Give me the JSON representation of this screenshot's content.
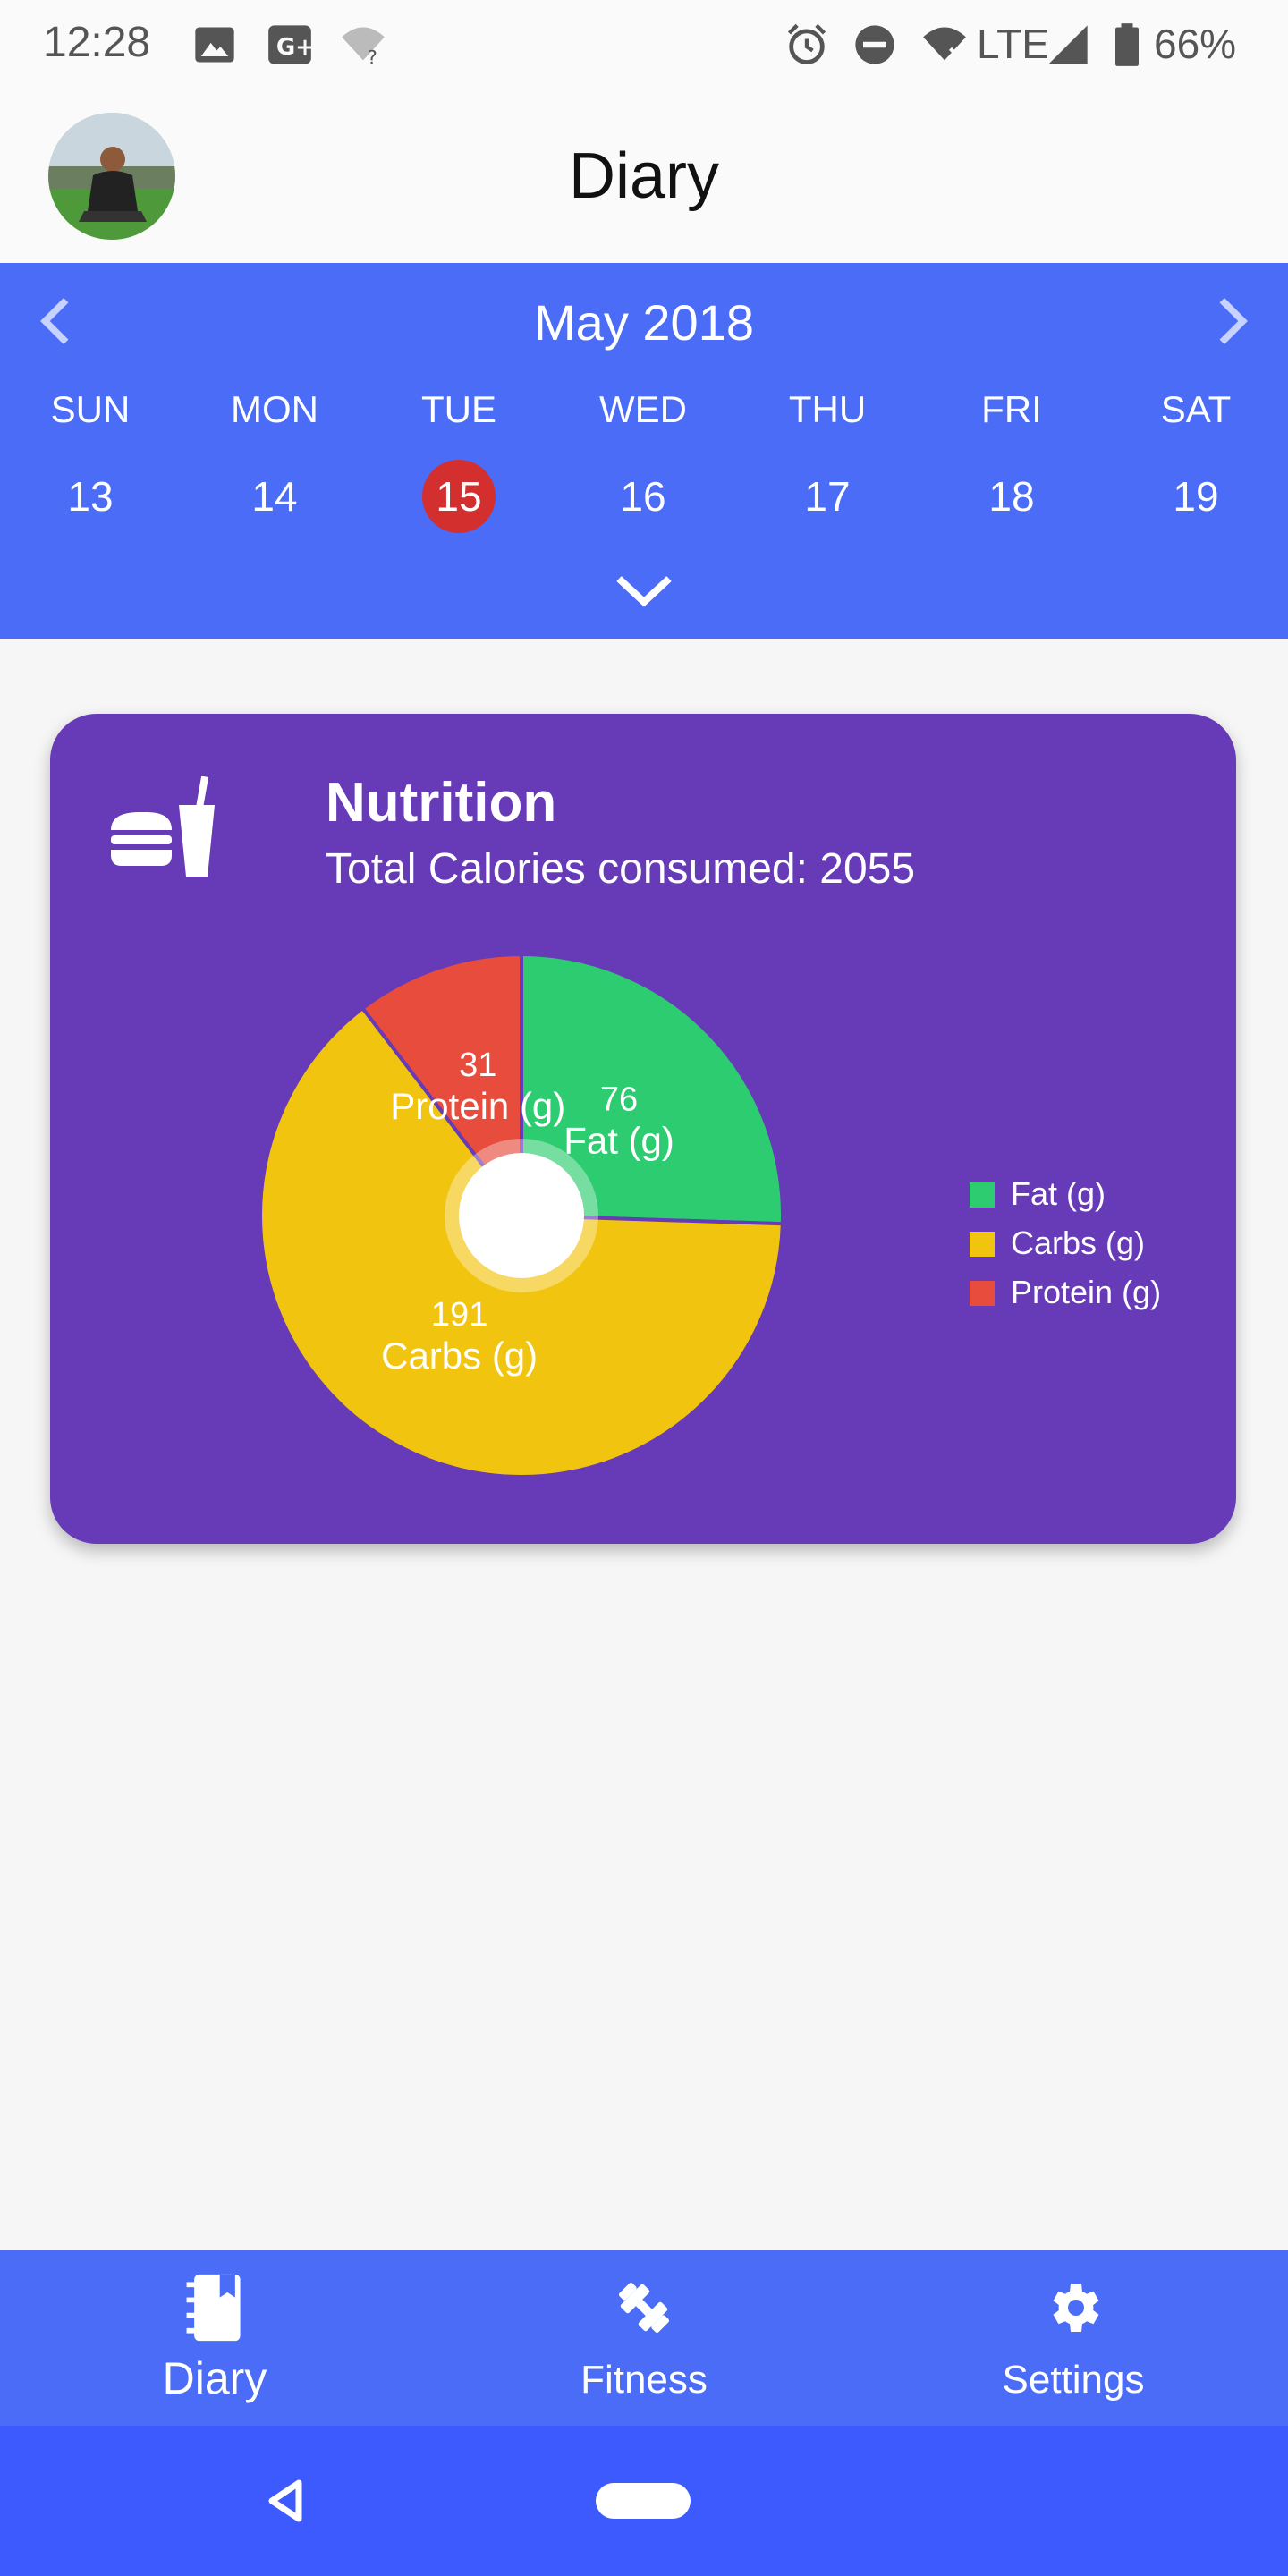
{
  "status_bar": {
    "time": "12:28",
    "network": "LTE",
    "battery": "66%",
    "icons": [
      "image-icon",
      "google-plus-icon",
      "wifi-unknown-icon",
      "alarm-icon",
      "do-not-disturb-icon",
      "wifi-off-icon",
      "signal-icon",
      "battery-icon"
    ]
  },
  "app_bar": {
    "title": "Diary",
    "avatar": "profile-avatar"
  },
  "calendar": {
    "month": "May 2018",
    "days": [
      {
        "weekday": "SUN",
        "date": "13"
      },
      {
        "weekday": "MON",
        "date": "14"
      },
      {
        "weekday": "TUE",
        "date": "15",
        "selected": true
      },
      {
        "weekday": "WED",
        "date": "16"
      },
      {
        "weekday": "THU",
        "date": "17"
      },
      {
        "weekday": "FRI",
        "date": "18"
      },
      {
        "weekday": "SAT",
        "date": "19"
      }
    ],
    "accent": "#4a6cf7",
    "selected_color": "#d32f2f"
  },
  "nutrition_card": {
    "title": "Nutrition",
    "subtitle": "Total Calories consumed: 2055",
    "icon": "food-drink-icon",
    "background": "#673ab7"
  },
  "chart_data": {
    "type": "pie",
    "title": "",
    "series": [
      {
        "name": "Fat (g)",
        "value": 76,
        "color": "#2ecc71"
      },
      {
        "name": "Carbs (g)",
        "value": 191,
        "color": "#f1c40f"
      },
      {
        "name": "Protein (g)",
        "value": 31,
        "color": "#e74c3c"
      }
    ],
    "legend_position": "right",
    "center_hole": true
  },
  "bottom_nav": {
    "items": [
      {
        "label": "Diary",
        "icon": "diary-icon",
        "active": true
      },
      {
        "label": "Fitness",
        "icon": "dumbbell-icon",
        "active": false
      },
      {
        "label": "Settings",
        "icon": "gear-icon",
        "active": false
      }
    ]
  }
}
